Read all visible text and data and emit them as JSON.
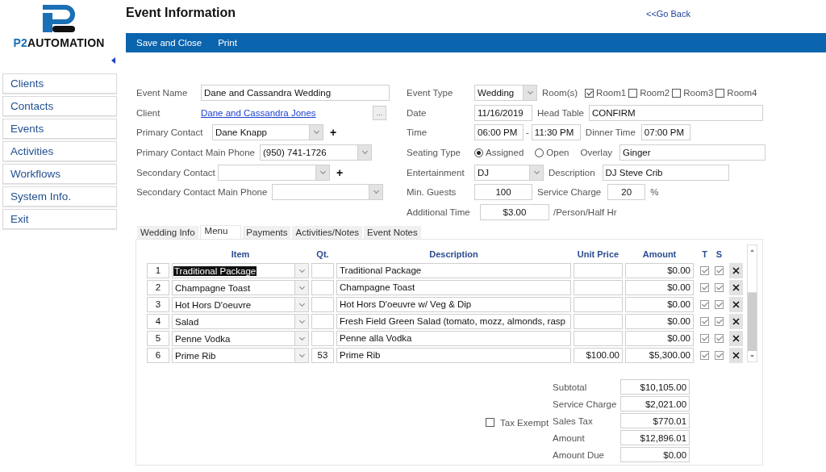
{
  "logo": {
    "prefix": "P2",
    "name": "AUTOMATION"
  },
  "title": "Event Information",
  "back_link": "<<Go Back",
  "toolbar": [
    {
      "label": "Save and Close"
    },
    {
      "label": "Print"
    }
  ],
  "sidebar": {
    "items": [
      {
        "label": "Clients"
      },
      {
        "label": "Contacts"
      },
      {
        "label": "Events"
      },
      {
        "label": "Activities"
      },
      {
        "label": "Workflows"
      },
      {
        "label": "System Info."
      },
      {
        "label": "Exit"
      }
    ]
  },
  "contact_fields": [
    {
      "label": "Event Name",
      "kind": "text",
      "value": "Dane and Cassandra Wedding"
    },
    {
      "label": "Client",
      "kind": "link",
      "value": "Dane and Cassandra Jones",
      "button": "..."
    },
    {
      "label": "Primary Contact",
      "kind": "combo",
      "value": "Dane Knapp",
      "add": "+"
    },
    {
      "label": "Primary Contact Main Phone",
      "kind": "combo",
      "value": "(950) 741-1726"
    },
    {
      "label": "Secondary Contact",
      "kind": "combo",
      "add": "+"
    },
    {
      "label": "Secondary Contact Main Phone",
      "kind": "combo"
    }
  ],
  "event_details": {
    "event_type": {
      "label": "Event Type",
      "value": "Wedding"
    },
    "rooms": {
      "label": "Room(s)",
      "options": [
        {
          "label": "Room1",
          "checked": true
        },
        {
          "label": "Room2",
          "checked": false
        },
        {
          "label": "Room3",
          "checked": false
        },
        {
          "label": "Room4",
          "checked": false
        }
      ]
    },
    "date": {
      "label": "Date",
      "value": "11/16/2019"
    },
    "head_table": {
      "label": "Head Table",
      "value": "CONFIRM"
    },
    "time": {
      "label": "Time",
      "start": "06:00 PM",
      "separator": "-",
      "end": "11:30 PM"
    },
    "dinner_time": {
      "label": "Dinner Time",
      "value": "07:00 PM"
    },
    "seating_type": {
      "label": "Seating Type",
      "options": [
        {
          "label": "Assigned",
          "selected": true
        },
        {
          "label": "Open",
          "selected": false
        }
      ]
    },
    "overlay": {
      "label": "Overlay",
      "value": "Ginger"
    },
    "entertainment": {
      "label": "Entertainment",
      "value": "DJ"
    },
    "description": {
      "label": "Description",
      "value": "DJ Steve Crib"
    },
    "min_guests": {
      "label": "Min. Guests",
      "value": "100"
    },
    "service_charge": {
      "label": "Service Charge",
      "value": "20",
      "unit": "%"
    },
    "additional_time": {
      "label": "Additional Time",
      "value": "$3.00",
      "unit": "/Person/Half Hr"
    }
  },
  "tabs": [
    {
      "label": "Wedding Info",
      "selected": false
    },
    {
      "label": "Menu",
      "selected": true
    },
    {
      "label": "Payments",
      "selected": false
    },
    {
      "label": "Activities/Notes",
      "selected": false
    },
    {
      "label": "Event Notes",
      "selected": false
    }
  ],
  "menu_table": {
    "columns": [
      "Item",
      "Qt.",
      "Description",
      "Unit Price",
      "Amount",
      "T",
      "S"
    ],
    "rows": [
      {
        "line": "1",
        "item": "Traditional Package",
        "selected": true,
        "description": "Traditional Package",
        "amount": "$0.00",
        "t": true,
        "s": true
      },
      {
        "line": "2",
        "item": "Champagne Toast",
        "selected": false,
        "description": "Champagne Toast",
        "amount": "$0.00",
        "t": true,
        "s": true
      },
      {
        "line": "3",
        "item": "Hot Hors D'oeuvre",
        "selected": false,
        "description": "Hot Hors D'oeuvre w/ Veg & Dip",
        "amount": "$0.00",
        "t": true,
        "s": true
      },
      {
        "line": "4",
        "item": "Salad",
        "selected": false,
        "description": "Fresh Field Green Salad (tomato, mozz, almonds, rasp",
        "amount": "$0.00",
        "t": true,
        "s": true
      },
      {
        "line": "5",
        "item": "Penne Vodka",
        "selected": false,
        "description": "Penne alla Vodka",
        "amount": "$0.00",
        "t": true,
        "s": true
      },
      {
        "line": "6",
        "item": "Prime Rib",
        "selected": false,
        "qty": "53",
        "description": "Prime Rib",
        "unit_price": "$100.00",
        "amount": "$5,300.00",
        "t": true,
        "s": true
      }
    ]
  },
  "tax_exempt": {
    "label": "Tax Exempt",
    "checked": false
  },
  "totals": [
    {
      "label": "Subtotal",
      "value": "$10,105.00"
    },
    {
      "label": "Service Charge",
      "value": "$2,021.00"
    },
    {
      "label": "Sales Tax",
      "value": "$770.01"
    },
    {
      "label": "Amount",
      "value": "$12,896.01"
    },
    {
      "label": "Amount Due",
      "value": "$0.00"
    }
  ]
}
